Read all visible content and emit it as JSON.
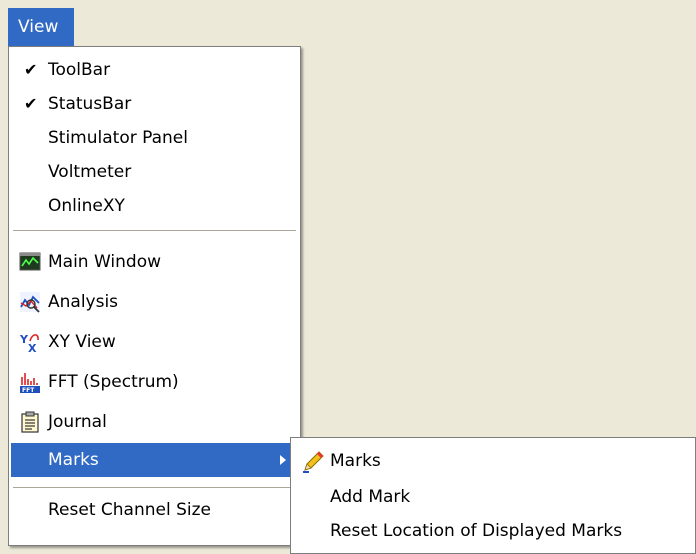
{
  "menu_bar": {
    "view_label": "View"
  },
  "view_menu": {
    "items": [
      {
        "label": "ToolBar",
        "checked": "✔"
      },
      {
        "label": "StatusBar",
        "checked": "✔"
      },
      {
        "label": "Stimulator Panel"
      },
      {
        "label": "Voltmeter"
      },
      {
        "label": "OnlineXY"
      },
      {
        "label": "Main Window",
        "icon": "main-window-icon"
      },
      {
        "label": "Analysis",
        "icon": "analysis-icon"
      },
      {
        "label": "XY View",
        "icon": "xy-view-icon"
      },
      {
        "label": "FFT (Spectrum)",
        "icon": "fft-icon"
      },
      {
        "label": "Journal",
        "icon": "journal-icon"
      },
      {
        "label": "Marks",
        "has_submenu": true
      },
      {
        "label": "Reset Channel Size"
      }
    ]
  },
  "marks_submenu": {
    "items": [
      {
        "label": "Marks",
        "icon": "pencil-icon"
      },
      {
        "label": "Add Mark"
      },
      {
        "label": "Reset Location of Displayed Marks"
      }
    ]
  },
  "colors": {
    "highlight": "#316ac5",
    "background": "#ece9d8",
    "menu_bg": "#ffffff"
  }
}
